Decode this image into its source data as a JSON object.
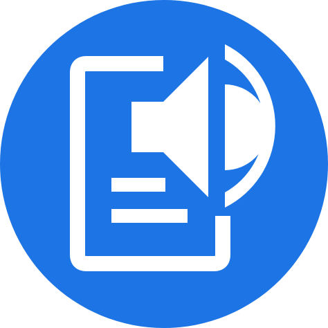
{
  "icon": {
    "name": "audio-document-icon",
    "background_color": "#1D74E5",
    "foreground_color": "#FFFFFF"
  }
}
